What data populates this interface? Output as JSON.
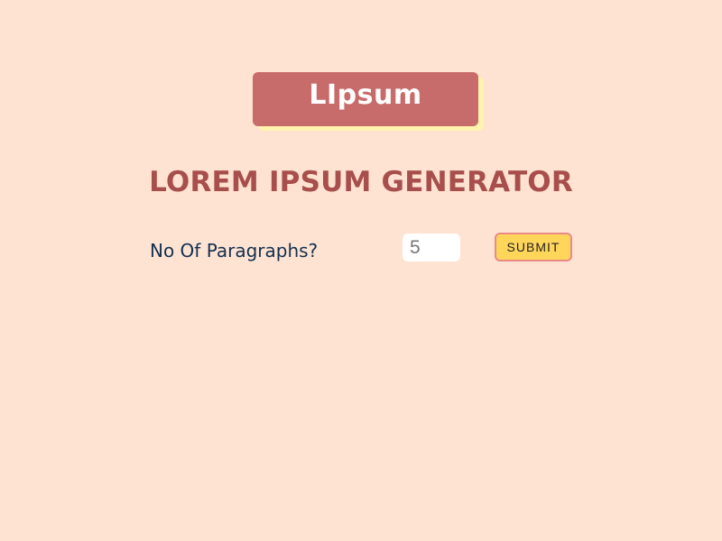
{
  "header": {
    "logo_text": "LIpsum"
  },
  "main": {
    "title": "LOREM IPSUM GENERATOR",
    "form": {
      "label": "No Of Paragraphs?",
      "paragraphs_value": "5",
      "submit_label": "SUBMIT"
    }
  },
  "colors": {
    "background": "#ffe3d2",
    "logo_bg": "#c86b6b",
    "logo_shadow": "#fff3b0",
    "title": "#a84f4d",
    "label": "#123050",
    "submit_bg": "#ffd65a",
    "submit_border": "#e88a86"
  }
}
